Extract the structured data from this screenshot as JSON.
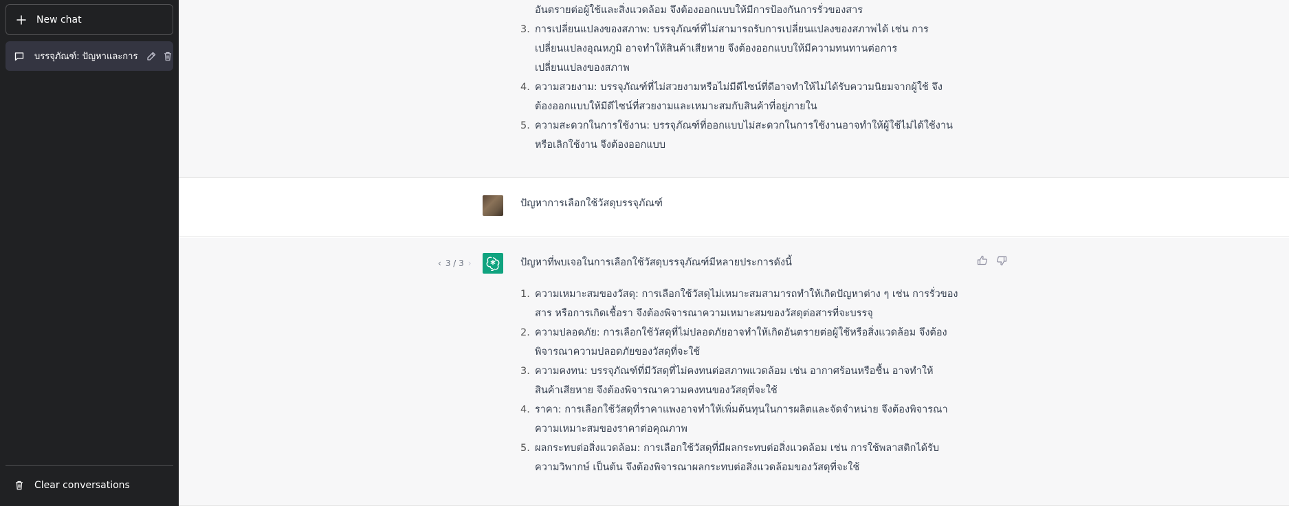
{
  "sidebar": {
    "new_chat_label": "New chat",
    "conversation_title": "บรรจุภัณฑ์: ปัญหาและการ",
    "clear_label": "Clear conversations"
  },
  "colors": {
    "sidebar_bg": "#202123",
    "selected_item": "#343541",
    "bot_accent": "#10a37f",
    "gray_block": "#f7f7f8"
  },
  "messages": {
    "previous_answer": {
      "partial_line": "อันตรายต่อผู้ใช้และสิ่งแวดล้อม จึงต้องออกแบบให้มีการป้องกันการรั่วของสาร",
      "items": [
        {
          "num": "3.",
          "lines": [
            "การเปลี่ยนแปลงของสภาพ: บรรจุภัณฑ์ที่ไม่สามารถรับการเปลี่ยนแปลงของสภาพได้ เช่น การ",
            "เปลี่ยนแปลงอุณหภูมิ อาจทำให้สินค้าเสียหาย จึงต้องออกแบบให้มีความทนทานต่อการ",
            "เปลี่ยนแปลงของสภาพ"
          ]
        },
        {
          "num": "4.",
          "lines": [
            "ความสวยงาม: บรรจุภัณฑ์ที่ไม่สวยงามหรือไม่มีดีไซน์ที่ดีอาจทำให้ไม่ได้รับความนิยมจากผู้ใช้ จึง",
            "ต้องออกแบบให้มีดีไซน์ที่สวยงามและเหมาะสมกับสินค้าที่อยู่ภายใน"
          ]
        },
        {
          "num": "5.",
          "lines": [
            "ความสะดวกในการใช้งาน: บรรจุภัณฑ์ที่ออกแบบไม่สะดวกในการใช้งานอาจทำให้ผู้ใช้ไม่ได้ใช้งาน",
            "หรือเลิกใช้งาน จึงต้องออกแบบ"
          ]
        }
      ]
    },
    "user_question": "ปัญหาการเลือกใช้วัสดุบรรจุภัณฑ์",
    "answer": {
      "pager": "3 / 3",
      "intro": "ปัญหาที่พบเจอในการเลือกใช้วัสดุบรรจุภัณฑ์มีหลายประการดังนี้",
      "items": [
        {
          "num": "1.",
          "lines": [
            "ความเหมาะสมของวัสดุ: การเลือกใช้วัสดุไม่เหมาะสมสามารถทำให้เกิดปัญหาต่าง ๆ เช่น การรั่วของ",
            "สาร หรือการเกิดเชื้อรา จึงต้องพิจารณาความเหมาะสมของวัสดุต่อสารที่จะบรรจุ"
          ]
        },
        {
          "num": "2.",
          "lines": [
            "ความปลอดภัย: การเลือกใช้วัสดุที่ไม่ปลอดภัยอาจทำให้เกิดอันตรายต่อผู้ใช้หรือสิ่งแวดล้อม จึงต้อง",
            "พิจารณาความปลอดภัยของวัสดุที่จะใช้"
          ]
        },
        {
          "num": "3.",
          "lines": [
            "ความคงทน: บรรจุภัณฑ์ที่มีวัสดุที่ไม่คงทนต่อสภาพแวดล้อม เช่น อากาศร้อนหรือชื้น อาจทำให้",
            "สินค้าเสียหาย จึงต้องพิจารณาความคงทนของวัสดุที่จะใช้"
          ]
        },
        {
          "num": "4.",
          "lines": [
            "ราคา: การเลือกใช้วัสดุที่ราคาแพงอาจทำให้เพิ่มต้นทุนในการผลิตและจัดจำหน่าย จึงต้องพิจารณา",
            "ความเหมาะสมของราคาต่อคุณภาพ"
          ]
        },
        {
          "num": "5.",
          "lines": [
            "ผลกระทบต่อสิ่งแวดล้อม: การเลือกใช้วัสดุที่มีผลกระทบต่อสิ่งแวดล้อม เช่น การใช้พลาสติกได้รับ",
            "ความวิพากษ์ เป็นต้น จึงต้องพิจารณาผลกระทบต่อสิ่งแวดล้อมของวัสดุที่จะใช้"
          ]
        }
      ]
    }
  }
}
